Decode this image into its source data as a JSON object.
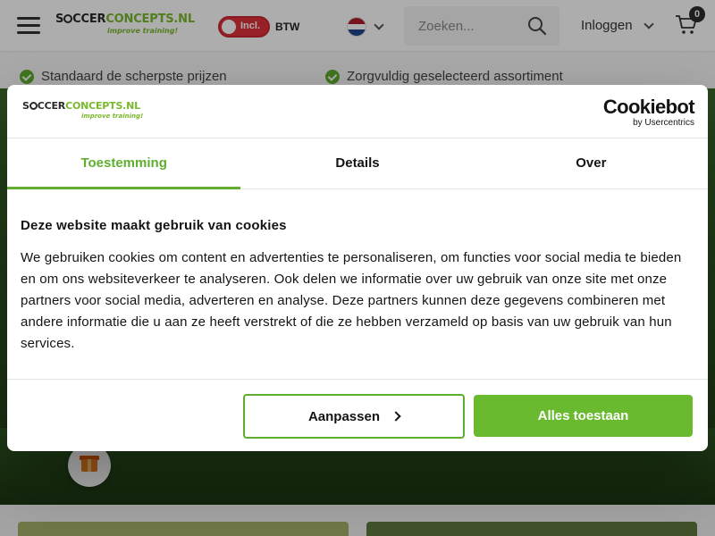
{
  "header": {
    "logo": {
      "part1": "S",
      "part2": "CCER",
      "part3": "CONCEPTS.NL",
      "tagline": "improve training!"
    },
    "vat_toggle": {
      "pill_label": "Incl.",
      "label": "BTW"
    },
    "search": {
      "placeholder": "Zoeken..."
    },
    "login_label": "Inloggen",
    "cart_count": "0"
  },
  "usp": {
    "items": [
      {
        "label": "Standaard de scherpste prijzen"
      },
      {
        "label": "Zorgvuldig geselecteerd assortiment"
      }
    ]
  },
  "cookie_dialog": {
    "logo": {
      "part1": "S",
      "part2": "CCER",
      "part3": "CONCEPTS.NL",
      "tagline": "improve training!"
    },
    "provider": {
      "name": "Cookiebot",
      "sub": "by Usercentrics"
    },
    "tabs": [
      {
        "label": "Toestemming",
        "active": true
      },
      {
        "label": "Details",
        "active": false
      },
      {
        "label": "Over",
        "active": false
      }
    ],
    "title": "Deze website maakt gebruik van cookies",
    "body": "We gebruiken cookies om content en advertenties te personaliseren, om functies voor social media te bieden en om ons websiteverkeer te analyseren. Ook delen we informatie over uw gebruik van onze site met onze partners voor social media, adverteren en analyse. Deze partners kunnen deze gegevens combineren met andere informatie die u aan ze heeft verstrekt of die ze hebben verzameld op basis van uw gebruik van hun services.",
    "customize_label": "Aanpassen",
    "accept_label": "Alles toestaan"
  },
  "colors": {
    "accent": "#5fae2f",
    "accept_button": "#6aba2f",
    "vat_toggle": "#e0313b",
    "flag": [
      "#ae1c28",
      "#ffffff",
      "#21468b"
    ]
  },
  "icons": [
    "menu-icon",
    "search-icon",
    "chevron-down-icon",
    "cart-icon",
    "check-icon",
    "gift-icon",
    "chevron-right-icon",
    "flag-nl-icon"
  ]
}
